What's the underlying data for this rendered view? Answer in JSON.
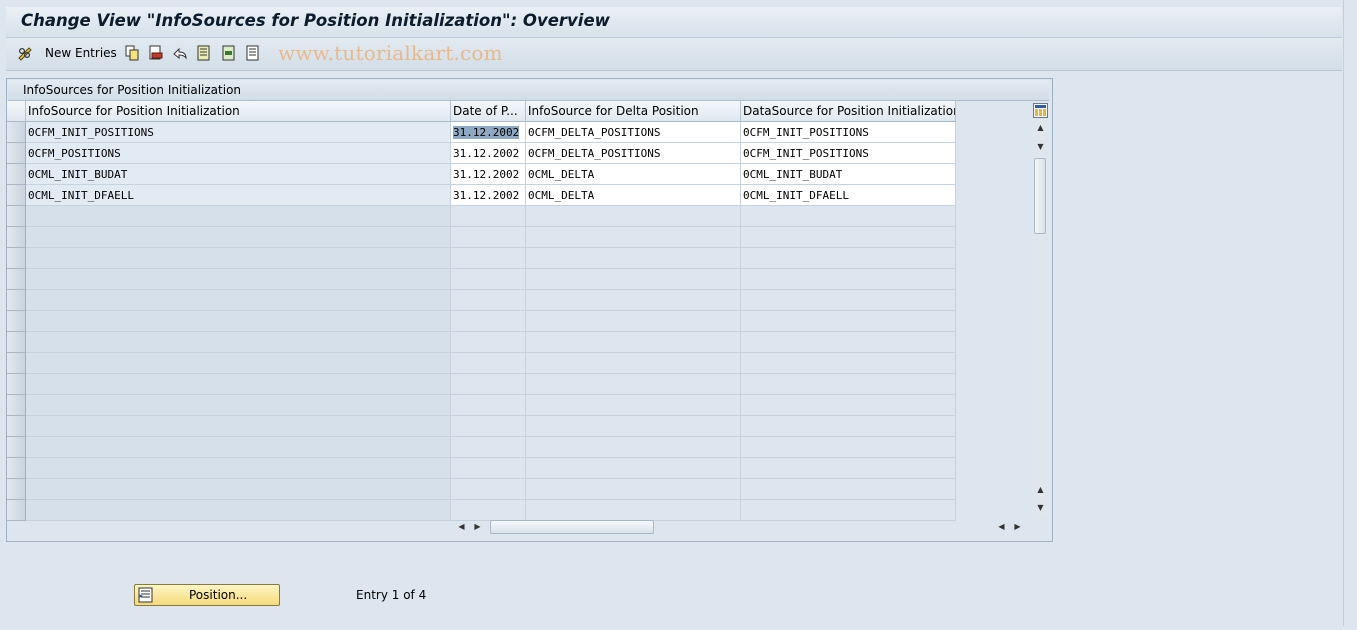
{
  "window": {
    "title": "Change View \"InfoSources for Position Initialization\": Overview"
  },
  "toolbar": {
    "new_entries_label": "New Entries",
    "watermark": "www.tutorialkart.com",
    "icons": [
      "edit-glasses-icon",
      "copy-icon",
      "delete-icon",
      "undo-icon",
      "select-all-icon",
      "select-block-icon",
      "deselect-all-icon"
    ]
  },
  "panel": {
    "title": "InfoSources for Position Initialization"
  },
  "table": {
    "columns": [
      "InfoSource for Position Initialization",
      "Date of P...",
      "InfoSource for Delta Position",
      "DataSource for Position Initialization"
    ],
    "rows": [
      [
        "0CFM_INIT_POSITIONS",
        "31.12.2002",
        "0CFM_DELTA_POSITIONS",
        "0CFM_INIT_POSITIONS"
      ],
      [
        "0CFM_POSITIONS",
        "31.12.2002",
        "0CFM_DELTA_POSITIONS",
        "0CFM_INIT_POSITIONS"
      ],
      [
        "0CML_INIT_BUDAT",
        "31.12.2002",
        "0CML_DELTA",
        "0CML_INIT_BUDAT"
      ],
      [
        "0CML_INIT_DFAELL",
        "31.12.2002",
        "0CML_DELTA",
        "0CML_INIT_DFAELL"
      ]
    ],
    "empty_rows": 15,
    "selected_cell": "31.12.2002"
  },
  "footer": {
    "position_button_label": "Position...",
    "entry_text": "Entry 1 of 4"
  },
  "colors": {
    "background": "#dde6ee",
    "key_cell": "#e2ebf3",
    "data_cell": "#ffffff",
    "selection": "#8fa9c4",
    "button": "#f5d97a",
    "watermark": "#e9b98a"
  }
}
